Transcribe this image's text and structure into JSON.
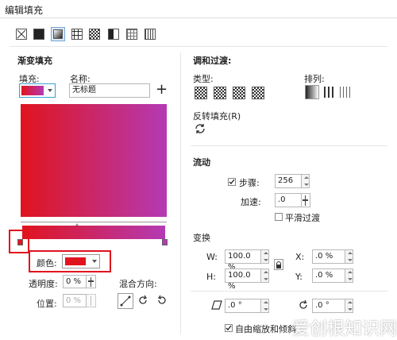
{
  "window": {
    "title": "编辑填充"
  },
  "toolbar": {
    "icons": [
      "no-fill-icon",
      "uniform-fill-icon",
      "fountain-fill-icon",
      "vector-pattern-icon",
      "bitmap-pattern-icon",
      "two-color-pattern-icon",
      "texture-fill-icon",
      "postscript-fill-icon"
    ]
  },
  "left": {
    "section_title": "渐变填充",
    "fill_label": "填充:",
    "name_label": "名称:",
    "name_value": "无标题",
    "color_label": "颜色:",
    "transparency_label": "透明度:",
    "transparency_value": "0 %",
    "position_label": "位置:",
    "position_value": "0 %",
    "blend_dir_label": "混合方向:"
  },
  "right": {
    "blend_title": "调和过渡:",
    "type_label": "类型:",
    "arrange_label": "排列:",
    "reverse_label": "反转填充(R)",
    "flow_title": "流动",
    "steps_label": "步骤:",
    "steps_value": "256",
    "accel_label": "加速:",
    "accel_value": ".0",
    "smooth_label": "平滑过渡",
    "transform_title": "变换",
    "w_label": "W:",
    "w_value": "100.0 %",
    "h_label": "H:",
    "h_value": "100.0 %",
    "x_label": "X:",
    "x_value": ".0 %",
    "y_label": "Y:",
    "y_value": ".0 %",
    "skew_value": ".0 °",
    "rotate_value": ".0 °",
    "free_scale_label": "自由缩放和倾斜"
  },
  "watermark": "爱创根知识网",
  "colors": {
    "gradient_start": "#e0141e",
    "gradient_end": "#b43ab4",
    "highlight": "#e0141e"
  }
}
